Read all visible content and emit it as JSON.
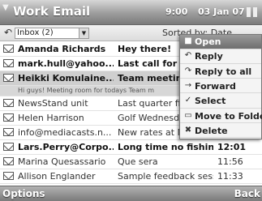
{
  "window": {
    "title": "Work Email",
    "time": "9:00",
    "date": "03 Jan 07"
  },
  "toolbar": {
    "folder_value": "Inbox (2)",
    "sort_label": "Sorted by: Date"
  },
  "messages": [
    {
      "sender": "Amanda Richards",
      "subject": "Hey there!",
      "time": "",
      "unread": true
    },
    {
      "sender": "mark.hull@yahoo...",
      "subject": "Last call for th",
      "time": "",
      "unread": true
    },
    {
      "sender": "Heikki Komulaine...",
      "subject": "Team meeting",
      "time": "",
      "unread": true,
      "highlighted": true,
      "preview": "Hi guys! Meeting room for todays Team m"
    },
    {
      "sender": "NewsStand unit",
      "subject": "Last quarter fig",
      "time": "",
      "unread": false
    },
    {
      "sender": "Helen Harrison",
      "subject": "Golf Wednesday",
      "time": "",
      "unread": false
    },
    {
      "sender": "info@mediacasts.n...",
      "subject": "New rates at M",
      "time": "",
      "unread": false
    },
    {
      "sender": "Lars.Perry@Corpo...",
      "subject": "Long time no fishin...",
      "time": "12:01",
      "unread": true
    },
    {
      "sender": "Marina Quesassario",
      "subject": "Que sera",
      "time": "11:56",
      "unread": false
    },
    {
      "sender": "Allison Englander",
      "subject": "Sample feedback sessi...",
      "time": "11:33",
      "unread": false
    }
  ],
  "menu": {
    "items": [
      {
        "label": "Open",
        "icon": "open-icon",
        "selected": true
      },
      {
        "label": "Reply",
        "icon": "reply-icon"
      },
      {
        "label": "Reply to all",
        "icon": "reply-all-icon"
      },
      {
        "label": "Forward",
        "icon": "forward-icon"
      },
      {
        "label": "Select",
        "icon": "checkmark-icon"
      },
      {
        "label": "Move to Folder",
        "icon": "folder-icon"
      },
      {
        "label": "Delete",
        "icon": "delete-icon"
      }
    ]
  },
  "softkeys": {
    "left": "Options",
    "right": "Back"
  }
}
